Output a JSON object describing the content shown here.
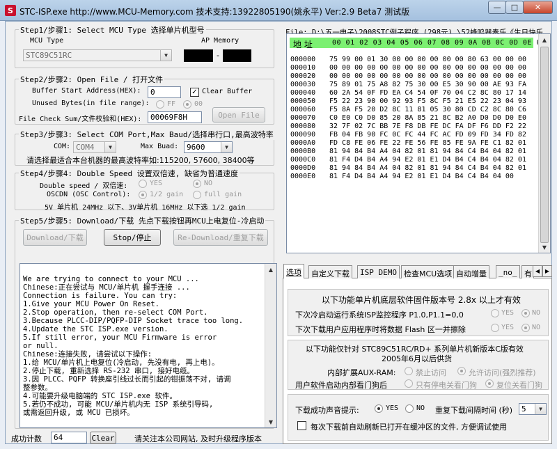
{
  "window": {
    "title": "STC-ISP.exe http://www.MCU-Memory.com 技术支持:13922805190(姚永平) Ver:2.9 Beta7 测试版",
    "controls": {
      "minimize": "—",
      "maximize": "□",
      "close": "✕"
    }
  },
  "step1": {
    "title": "Step1/步骤1: Select MCU Type  选择单片机型号",
    "mcu_type_label": "MCU Type",
    "ap_memory_label": "AP Memory",
    "mcu_value": "STC89C51RC",
    "ap_separator": "-"
  },
  "step2": {
    "title": "Step2/步骤2: Open File / 打开文件",
    "buffer_start_label": "Buffer Start Address(HEX):",
    "buffer_start_value": "0",
    "clear_buffer_label": "Clear Buffer",
    "clear_buffer_checked": true,
    "unused_bytes_label": "Unused Bytes(in file range):",
    "ff_label": "FF",
    "zero_label": "00",
    "checksum_label": "File Check Sum/文件校验和(HEX):",
    "checksum_value": "00069F8H",
    "open_file_label": "Open File"
  },
  "step3": {
    "title": "Step3/步骤3: Select COM Port,Max Baud/选择串行口,最高波特率",
    "com_label": "COM:",
    "com_value": "COM4",
    "max_baud_label": "Max Buad:",
    "max_baud_value": "9600",
    "note": "请选择最适合本台机器的最高波特率如:115200, 57600, 38400等"
  },
  "step4": {
    "title": "Step4/步骤4: Double Speed  设置双倍速, 缺省为普通速度",
    "double_speed_label": "Double speed / 双倍速:",
    "yes_label": "YES",
    "no_label": "NO",
    "oscdn_label": "OSCDN (OSC Control):",
    "half_gain_label": "1/2 gain",
    "full_gain_label": "full gain",
    "note": "5V 单片机 24MHz 以下、3V单片机 16MHz 以下选 1/2 gain"
  },
  "step5": {
    "title": "Step5/步骤5: Download/下载  先点下载按钮再MCU上电复位-冷启动",
    "download_label": "Download/下载",
    "stop_label": "Stop/停止",
    "redownload_label": "Re-Download/重复下载"
  },
  "log": {
    "lines": [
      "We are trying to connect to your MCU ...",
      "Chinese:正在尝试与 MCU/单片机 握手连接 ...",
      "Connection is failure. You can try:",
      " 1.Give your MCU Power On Reset.",
      " 2.Stop operation, then re-select COM Port.",
      " 3.Because PLCC-DIP/PQFP-DIP Socket trace too long.",
      " 4.Update the STC ISP.exe version.",
      " 5.If still error, your MCU Firmware is error",
      "    or null.",
      "Chinese:连接失败, 请尝试以下操作:",
      " 1.给 MCU/单片机上电复位(冷启动, 先没有电, 再上电)。",
      " 2.停止下载, 重新选择 RS-232 串口, 接好电缆。",
      " 3.因 PLCC、PQFP 转换座引线过长而引起的钳振荡不对, 请调",
      "整参数。",
      " 4.可能要升级电脑端的 STC ISP.exe 软件。",
      " 5.若仍不成功, 可能 MCU/单片机内无 ISP 系统引导码,",
      "   或需返回升级, 或 MCU 已损坏。"
    ]
  },
  "status": {
    "success_count_label": "成功计数",
    "success_count_value": "64",
    "clear_label": "Clear",
    "notice": "请关注本公司网站, 及时升级程序版本"
  },
  "file": {
    "label": "File: D:\\五一电子\\2008STC例子程序 (298元) \\52蜂鸣器奏乐《生日快乐"
  },
  "hex": {
    "header_label": "地 址",
    "header_cols": "00 01 02 03 04 05 06 07 08 09 0A 0B 0C 0D 0E 0F",
    "rows": [
      {
        "addr": "000000",
        "data": "75 99 00 01 30 00 00 00 00 00 00 80 63 00 00 00"
      },
      {
        "addr": "000010",
        "data": "00 00 00 00 00 00 00 00 00 00 00 00 00 00 00 00"
      },
      {
        "addr": "000020",
        "data": "00 00 00 00 00 00 00 00 00 00 00 00 00 00 00 00"
      },
      {
        "addr": "000030",
        "data": "75 89 01 75 A8 82 75 30 00 E5 30 90 00 AE 93 FA"
      },
      {
        "addr": "000040",
        "data": "60 2A 54 0F FD EA C4 54 0F 70 04 C2 8C 80 17 14"
      },
      {
        "addr": "000050",
        "data": "F5 22 23 90 00 92 93 F5 8C F5 21 E5 22 23 04 93"
      },
      {
        "addr": "000060",
        "data": "F5 8A F5 20 D2 8C 11 81 05 30 80 CD C2 8C 80 C6"
      },
      {
        "addr": "000070",
        "data": "C0 E0 C0 D0 85 20 8A 85 21 8C B2 A0 D0 D0 D0 E0"
      },
      {
        "addr": "000080",
        "data": "32 7F 02 7C BB 7E F8 DB FE DC FA DF F6 DD F2 22"
      },
      {
        "addr": "000090",
        "data": "FB 04 FB 90 FC 0C FC 44 FC AC FD 09 FD 34 FD 82"
      },
      {
        "addr": "0000A0",
        "data": "FD C8 FE 06 FE 22 FE 56 FE 85 FE 9A FE C1 82 01"
      },
      {
        "addr": "0000B0",
        "data": "81 94 84 B4 A4 04 82 01 81 94 84 C4 B4 04 82 01"
      },
      {
        "addr": "0000C0",
        "data": "81 F4 D4 B4 A4 94 E2 01 E1 D4 B4 C4 B4 04 82 01"
      },
      {
        "addr": "0000D0",
        "data": "81 94 84 B4 A4 04 82 01 81 94 84 C4 B4 04 82 01"
      },
      {
        "addr": "0000E0",
        "data": "81 F4 D4 B4 A4 94 E2 01 E1 D4 B4 C4 B4 04 00"
      }
    ]
  },
  "tabs": {
    "items": [
      "选项",
      "自定义下载",
      "ISP DEMO",
      "检查MCU选项",
      "自动增量",
      "_no_",
      "有"
    ]
  },
  "options": {
    "note1": "以下功能单片机底层软件固件版本号 2.8x 以上才有效",
    "cold_start_label": "下次冷启动运行系统ISP监控程序 P1.0,P1.1=0,0",
    "flash_erase_label": "下次下载用户应用程序时将数据 Flash 区一并擦除",
    "yes_label": "YES",
    "no_label": "NO",
    "note2": "以下功能仅针对 STC89C51RC/RD+ 系列单片机新版本C版有效",
    "note2b": "2005年6月以后供货",
    "aux_ram_label": "内部扩展AUX-RAM:",
    "aux_ram_off": "禁止访问",
    "aux_ram_on": "允许访问(强烈推荐)",
    "watchdog_label": "用户软件启动内部看门狗后",
    "watchdog_opt1": "只有停电关看门狗",
    "watchdog_opt2": "复位关看门狗",
    "beep_label": "下载成功声音提示:",
    "repeat_interval_label": "重复下载间隔时间 (秒)",
    "repeat_interval_value": "5",
    "auto_open_label": "每次下载前自动刷新已打开在缓冲区的文件, 方便调试使用"
  }
}
